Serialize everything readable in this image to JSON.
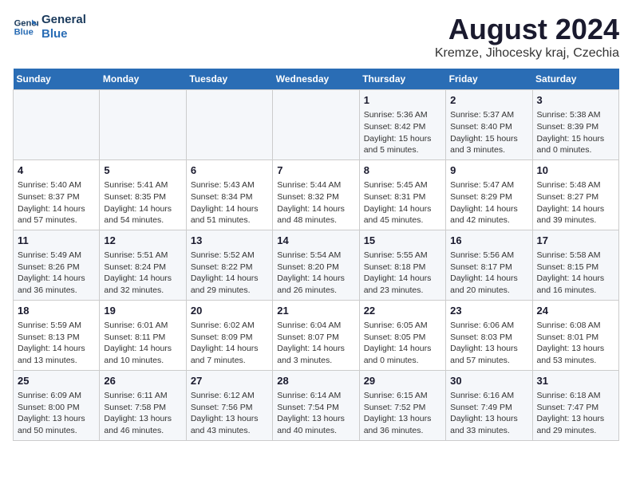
{
  "logo": {
    "line1": "General",
    "line2": "Blue"
  },
  "title": "August 2024",
  "subtitle": "Kremze, Jihocesky kraj, Czechia",
  "days_of_week": [
    "Sunday",
    "Monday",
    "Tuesday",
    "Wednesday",
    "Thursday",
    "Friday",
    "Saturday"
  ],
  "weeks": [
    [
      {
        "day": "",
        "content": ""
      },
      {
        "day": "",
        "content": ""
      },
      {
        "day": "",
        "content": ""
      },
      {
        "day": "",
        "content": ""
      },
      {
        "day": "1",
        "content": "Sunrise: 5:36 AM\nSunset: 8:42 PM\nDaylight: 15 hours\nand 5 minutes."
      },
      {
        "day": "2",
        "content": "Sunrise: 5:37 AM\nSunset: 8:40 PM\nDaylight: 15 hours\nand 3 minutes."
      },
      {
        "day": "3",
        "content": "Sunrise: 5:38 AM\nSunset: 8:39 PM\nDaylight: 15 hours\nand 0 minutes."
      }
    ],
    [
      {
        "day": "4",
        "content": "Sunrise: 5:40 AM\nSunset: 8:37 PM\nDaylight: 14 hours\nand 57 minutes."
      },
      {
        "day": "5",
        "content": "Sunrise: 5:41 AM\nSunset: 8:35 PM\nDaylight: 14 hours\nand 54 minutes."
      },
      {
        "day": "6",
        "content": "Sunrise: 5:43 AM\nSunset: 8:34 PM\nDaylight: 14 hours\nand 51 minutes."
      },
      {
        "day": "7",
        "content": "Sunrise: 5:44 AM\nSunset: 8:32 PM\nDaylight: 14 hours\nand 48 minutes."
      },
      {
        "day": "8",
        "content": "Sunrise: 5:45 AM\nSunset: 8:31 PM\nDaylight: 14 hours\nand 45 minutes."
      },
      {
        "day": "9",
        "content": "Sunrise: 5:47 AM\nSunset: 8:29 PM\nDaylight: 14 hours\nand 42 minutes."
      },
      {
        "day": "10",
        "content": "Sunrise: 5:48 AM\nSunset: 8:27 PM\nDaylight: 14 hours\nand 39 minutes."
      }
    ],
    [
      {
        "day": "11",
        "content": "Sunrise: 5:49 AM\nSunset: 8:26 PM\nDaylight: 14 hours\nand 36 minutes."
      },
      {
        "day": "12",
        "content": "Sunrise: 5:51 AM\nSunset: 8:24 PM\nDaylight: 14 hours\nand 32 minutes."
      },
      {
        "day": "13",
        "content": "Sunrise: 5:52 AM\nSunset: 8:22 PM\nDaylight: 14 hours\nand 29 minutes."
      },
      {
        "day": "14",
        "content": "Sunrise: 5:54 AM\nSunset: 8:20 PM\nDaylight: 14 hours\nand 26 minutes."
      },
      {
        "day": "15",
        "content": "Sunrise: 5:55 AM\nSunset: 8:18 PM\nDaylight: 14 hours\nand 23 minutes."
      },
      {
        "day": "16",
        "content": "Sunrise: 5:56 AM\nSunset: 8:17 PM\nDaylight: 14 hours\nand 20 minutes."
      },
      {
        "day": "17",
        "content": "Sunrise: 5:58 AM\nSunset: 8:15 PM\nDaylight: 14 hours\nand 16 minutes."
      }
    ],
    [
      {
        "day": "18",
        "content": "Sunrise: 5:59 AM\nSunset: 8:13 PM\nDaylight: 14 hours\nand 13 minutes."
      },
      {
        "day": "19",
        "content": "Sunrise: 6:01 AM\nSunset: 8:11 PM\nDaylight: 14 hours\nand 10 minutes."
      },
      {
        "day": "20",
        "content": "Sunrise: 6:02 AM\nSunset: 8:09 PM\nDaylight: 14 hours\nand 7 minutes."
      },
      {
        "day": "21",
        "content": "Sunrise: 6:04 AM\nSunset: 8:07 PM\nDaylight: 14 hours\nand 3 minutes."
      },
      {
        "day": "22",
        "content": "Sunrise: 6:05 AM\nSunset: 8:05 PM\nDaylight: 14 hours\nand 0 minutes."
      },
      {
        "day": "23",
        "content": "Sunrise: 6:06 AM\nSunset: 8:03 PM\nDaylight: 13 hours\nand 57 minutes."
      },
      {
        "day": "24",
        "content": "Sunrise: 6:08 AM\nSunset: 8:01 PM\nDaylight: 13 hours\nand 53 minutes."
      }
    ],
    [
      {
        "day": "25",
        "content": "Sunrise: 6:09 AM\nSunset: 8:00 PM\nDaylight: 13 hours\nand 50 minutes."
      },
      {
        "day": "26",
        "content": "Sunrise: 6:11 AM\nSunset: 7:58 PM\nDaylight: 13 hours\nand 46 minutes."
      },
      {
        "day": "27",
        "content": "Sunrise: 6:12 AM\nSunset: 7:56 PM\nDaylight: 13 hours\nand 43 minutes."
      },
      {
        "day": "28",
        "content": "Sunrise: 6:14 AM\nSunset: 7:54 PM\nDaylight: 13 hours\nand 40 minutes."
      },
      {
        "day": "29",
        "content": "Sunrise: 6:15 AM\nSunset: 7:52 PM\nDaylight: 13 hours\nand 36 minutes."
      },
      {
        "day": "30",
        "content": "Sunrise: 6:16 AM\nSunset: 7:49 PM\nDaylight: 13 hours\nand 33 minutes."
      },
      {
        "day": "31",
        "content": "Sunrise: 6:18 AM\nSunset: 7:47 PM\nDaylight: 13 hours\nand 29 minutes."
      }
    ]
  ]
}
